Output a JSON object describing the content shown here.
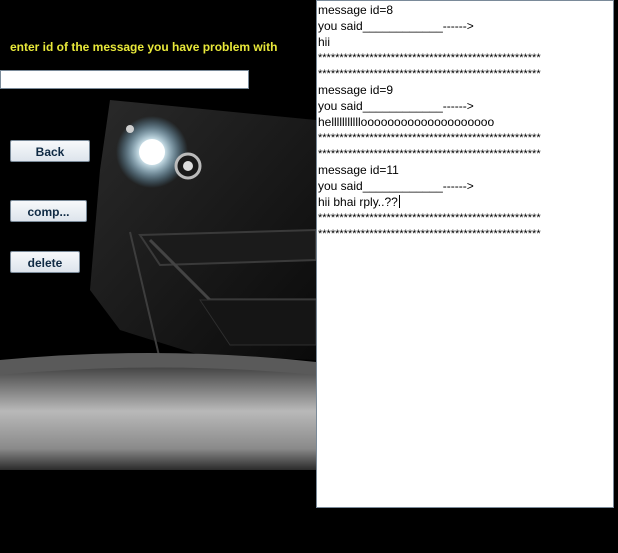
{
  "form": {
    "prompt": "enter id of the message you have problem with",
    "id_input_value": "",
    "back_label": "Back",
    "comp_label": "comp...",
    "delete_label": "delete"
  },
  "messages": [
    {
      "id_line": "message id=8",
      "said_line": "you said____________------>",
      "text": "hii",
      "separator1": "****************************************************",
      "separator2": "****************************************************"
    },
    {
      "id_line": "message id=9",
      "said_line": "you said____________------>",
      "text": "hellllllllllloooooooooooooooooooo",
      "separator1": "****************************************************",
      "separator2": "****************************************************"
    },
    {
      "id_line": "message id=11",
      "said_line": "you said____________------>",
      "text": "hii bhai rply..??",
      "separator1": "****************************************************",
      "separator2": "****************************************************"
    }
  ],
  "colors": {
    "prompt": "#e8e83a",
    "background": "#000000",
    "button_text": "#0f2a44"
  }
}
